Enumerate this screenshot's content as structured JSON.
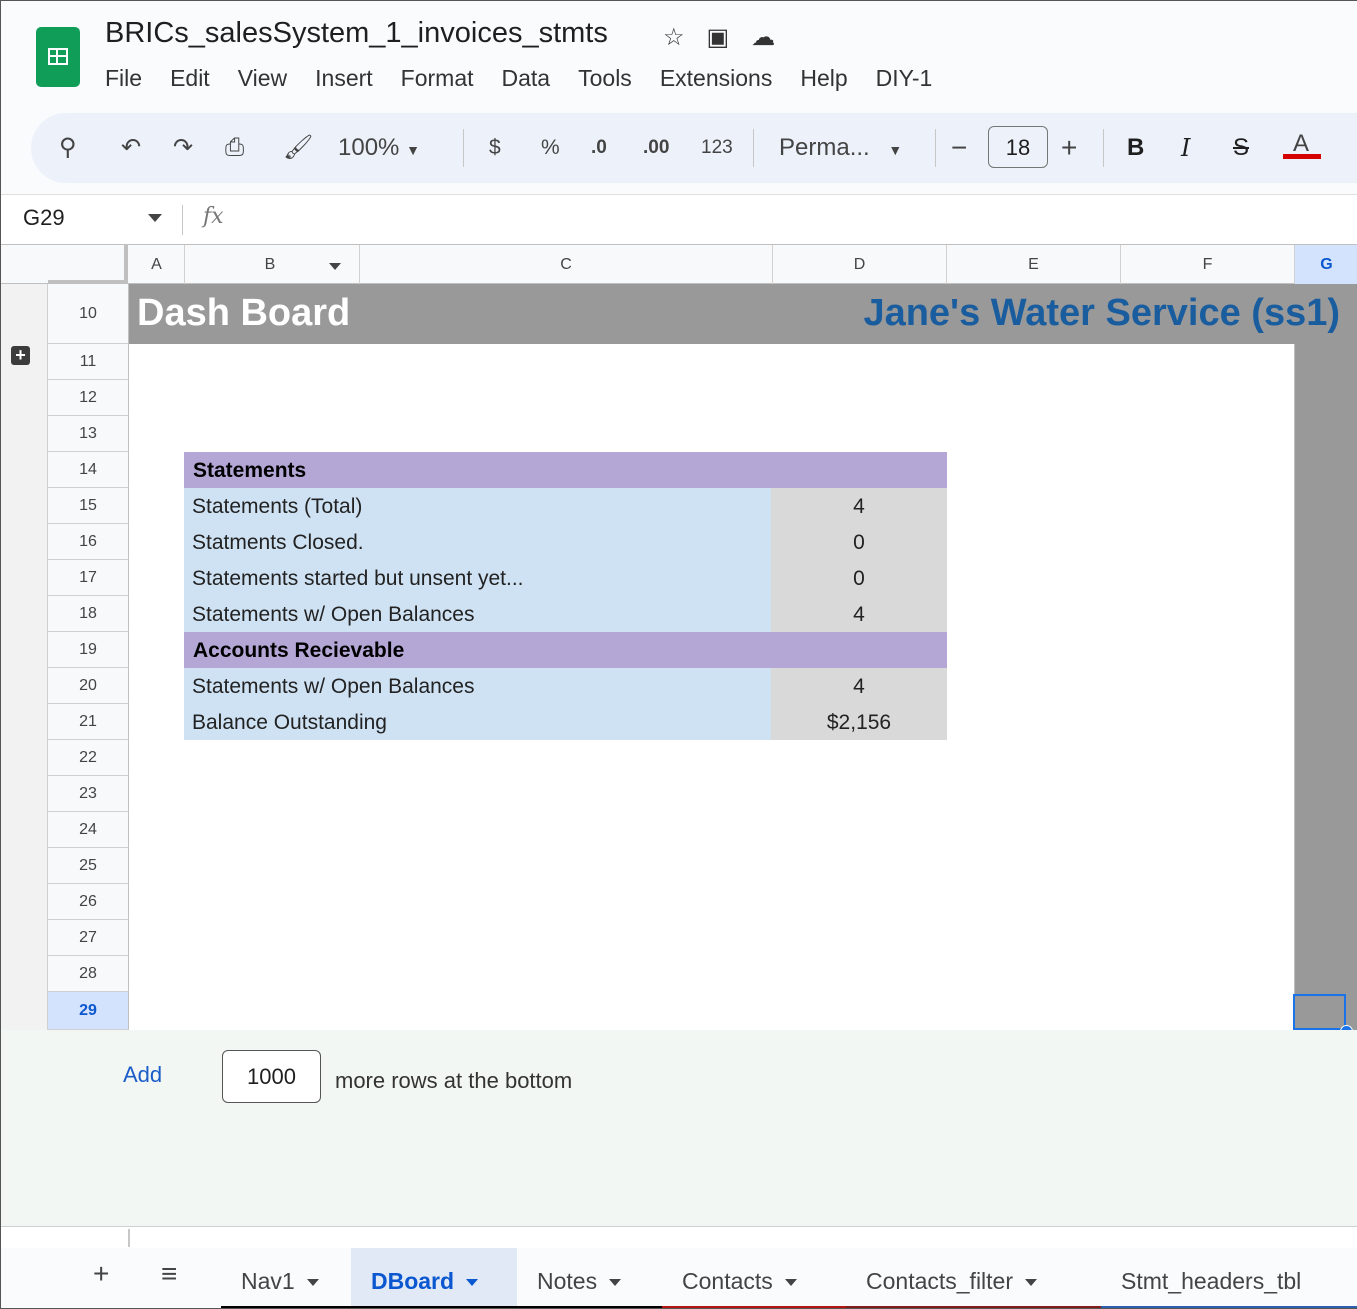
{
  "app": {
    "doc_title": "BRICs_salesSystem_1_invoices_stmts",
    "menu": [
      "File",
      "Edit",
      "View",
      "Insert",
      "Format",
      "Data",
      "Tools",
      "Extensions",
      "Help",
      "DIY-1"
    ]
  },
  "toolbar": {
    "zoom": "100%",
    "currency": "$",
    "percent": "%",
    "dec_decrease": ".0",
    "dec_increase": ".00",
    "number_format": "123",
    "font": "Perma...",
    "font_size": "18",
    "minus": "−",
    "plus": "+",
    "bold": "B",
    "italic": "I",
    "strike": "S",
    "text_color": "A"
  },
  "formula_bar": {
    "cell_ref": "G29",
    "fx": "fx"
  },
  "columns": [
    "A",
    "B",
    "C",
    "D",
    "E",
    "F",
    "G"
  ],
  "rows": [
    "10",
    "11",
    "12",
    "13",
    "14",
    "15",
    "16",
    "17",
    "18",
    "19",
    "20",
    "21",
    "22",
    "23",
    "24",
    "25",
    "26",
    "27",
    "28",
    "29"
  ],
  "sheet": {
    "banner_left": "Dash Board",
    "banner_right": "Jane's Water Service (ss1)",
    "section1_title": "Statements",
    "section1_rows": [
      {
        "label": "Statements (Total)",
        "value": "4"
      },
      {
        "label": "Statments Closed.",
        "value": "0"
      },
      {
        "label": "Statements started but unsent yet...",
        "value": "0"
      },
      {
        "label": "Statements w/ Open Balances",
        "value": "4"
      }
    ],
    "section2_title": "Accounts Recievable",
    "section2_rows": [
      {
        "label": "Statements w/ Open Balances",
        "value": "4"
      },
      {
        "label": "Balance Outstanding",
        "value": "$2,156"
      }
    ]
  },
  "add_rows": {
    "link": "Add",
    "count": "1000",
    "suffix": "more rows at the bottom"
  },
  "tabs": [
    {
      "label": "Nav1",
      "bar_color": "#000000"
    },
    {
      "label": "DBoard",
      "bar_color": "#000000"
    },
    {
      "label": "Notes",
      "bar_color": "#000000"
    },
    {
      "label": "Contacts",
      "bar_color": "#b31412"
    },
    {
      "label": "Contacts_filter",
      "bar_color": "#7f1d1d"
    },
    {
      "label": "Stmt_headers_tbl",
      "bar_color": "#2b5fad"
    }
  ],
  "colors": {
    "banner_bg": "#999999",
    "banner_title_right": "#1a5d9e",
    "section_header": "#b4a7d6",
    "label_fill": "#cfe2f3",
    "value_fill": "#d9d9d9",
    "active_tab": "#0b57d0"
  }
}
